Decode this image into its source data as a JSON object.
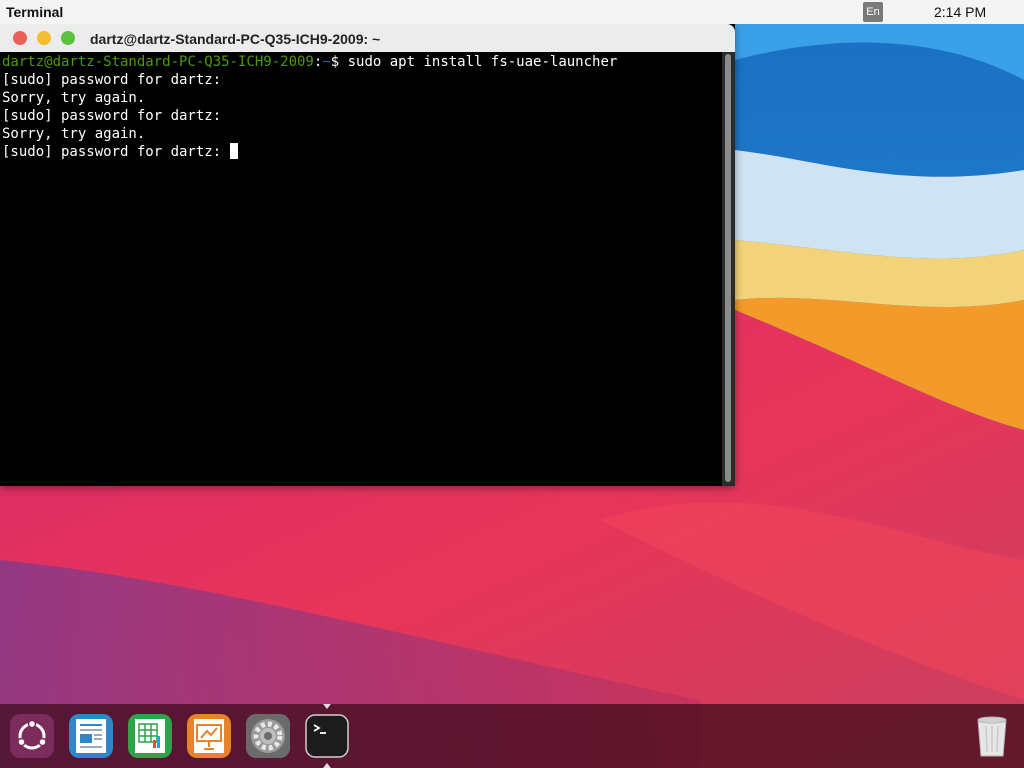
{
  "topbar": {
    "app_name": "Terminal",
    "language": "En",
    "clock": "2:14 PM"
  },
  "terminal": {
    "window_title": "dartz@dartz-Standard-PC-Q35-ICH9-2009: ~",
    "prompt_user_host": "dartz@dartz-Standard-PC-Q35-ICH9-2009",
    "prompt_sep": ":",
    "prompt_path": "~",
    "prompt_symbol": "$ ",
    "command": "sudo apt install fs-uae-launcher",
    "output_lines": [
      "[sudo] password for dartz:",
      "Sorry, try again.",
      "[sudo] password for dartz:",
      "Sorry, try again.",
      "[sudo] password for dartz: "
    ]
  },
  "dock": {
    "items": [
      {
        "name": "ubuntu-software",
        "icon": "ubuntu-logo-icon"
      },
      {
        "name": "writer",
        "icon": "libreoffice-writer-icon"
      },
      {
        "name": "calc",
        "icon": "libreoffice-calc-icon"
      },
      {
        "name": "impress",
        "icon": "libreoffice-impress-icon"
      },
      {
        "name": "settings",
        "icon": "settings-gear-icon"
      },
      {
        "name": "terminal",
        "icon": "terminal-icon",
        "running": true
      },
      {
        "name": "trash",
        "icon": "trash-icon"
      }
    ]
  },
  "colors": {
    "prompt_user": "#4e9a06",
    "prompt_path": "#3465a4",
    "close": "#ec5f57",
    "minimize": "#f5bd30",
    "maximize": "#5ac23d"
  }
}
